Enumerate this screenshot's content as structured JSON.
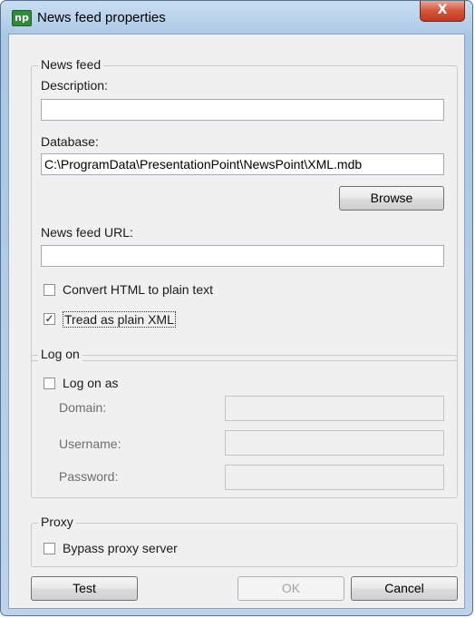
{
  "window": {
    "title": "News feed properties",
    "icon_text": "np",
    "close_label": "X"
  },
  "news_feed": {
    "legend": "News feed",
    "description_label": "Description:",
    "description_value": "",
    "database_label": "Database:",
    "database_value": "C:\\ProgramData\\PresentationPoint\\NewsPoint\\XML.mdb",
    "browse_label": "Browse",
    "url_label": "News feed URL:",
    "url_value": "",
    "convert_html_label": "Convert HTML to plain text",
    "convert_html_checked": false,
    "tread_xml_label": "Tread as plain XML",
    "tread_xml_checked": true,
    "check_mark": "✓"
  },
  "log_on": {
    "legend": "Log on",
    "log_on_as_label": "Log on as",
    "log_on_as_checked": false,
    "domain_label": "Domain:",
    "username_label": "Username:",
    "password_label": "Password:"
  },
  "proxy": {
    "legend": "Proxy",
    "bypass_label": "Bypass proxy server",
    "bypass_checked": false
  },
  "buttons": {
    "test": "Test",
    "ok": "OK",
    "cancel": "Cancel"
  },
  "colors": {
    "title_bar": "#bcd3ea",
    "close": "#c23a22",
    "client": "#f0f0f0"
  }
}
